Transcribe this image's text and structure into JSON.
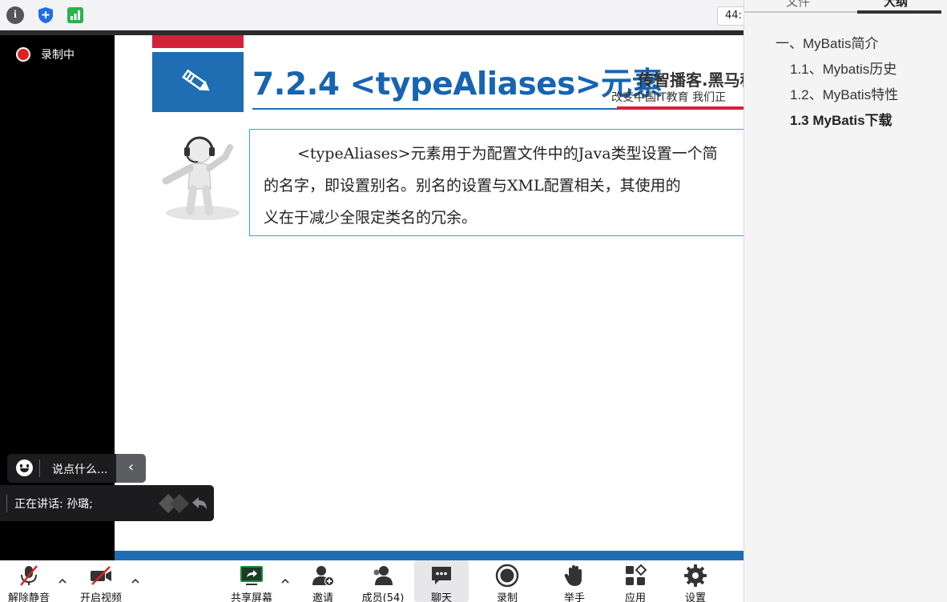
{
  "topbar": {
    "time_text": "44:",
    "icons": [
      "info-icon",
      "shield-icon",
      "signal-bars-icon"
    ]
  },
  "recording": {
    "label": "录制中"
  },
  "slide": {
    "title": "7.2.4 <typeAliases>元素",
    "brand": "传智播客.黑马程",
    "tagline": "改变中国IT教育 我们正",
    "body_line1": "<typeAliases>元素用于为配置文件中的Java类型设置一个简",
    "body_line2": "的名字，即设置别名。别名的设置与XML配置相关，其使用的",
    "body_line3": "义在于减少全限定类名的冗余。"
  },
  "chat": {
    "placeholder": "说点什么...",
    "collapse_glyph": "‹"
  },
  "speaking": {
    "text": "正在讲话: 孙璐;"
  },
  "toolbar": {
    "unmute": "解除静音",
    "start_video": "开启视频",
    "share_screen": "共享屏幕",
    "invite": "邀请",
    "members": "成员(54)",
    "chat": "聊天",
    "record": "录制",
    "raise_hand": "举手",
    "apps": "应用",
    "settings": "设置"
  },
  "right_panel": {
    "tabs": [
      {
        "label": "文件",
        "active": false
      },
      {
        "label": "大纲",
        "active": true
      }
    ],
    "outline": [
      {
        "label": "一、MyBatis简介",
        "level": 0,
        "bold": false
      },
      {
        "label": "1.1、Mybatis历史",
        "level": 1,
        "bold": false
      },
      {
        "label": "1.2、MyBatis特性",
        "level": 1,
        "bold": false
      },
      {
        "label": "1.3 MyBatis下载",
        "level": 1,
        "bold": true
      }
    ]
  },
  "colors": {
    "slide_blue": "#1764b3",
    "slide_red": "#d4203a",
    "record_red": "#e02222",
    "signal_green": "#2bb24c"
  }
}
